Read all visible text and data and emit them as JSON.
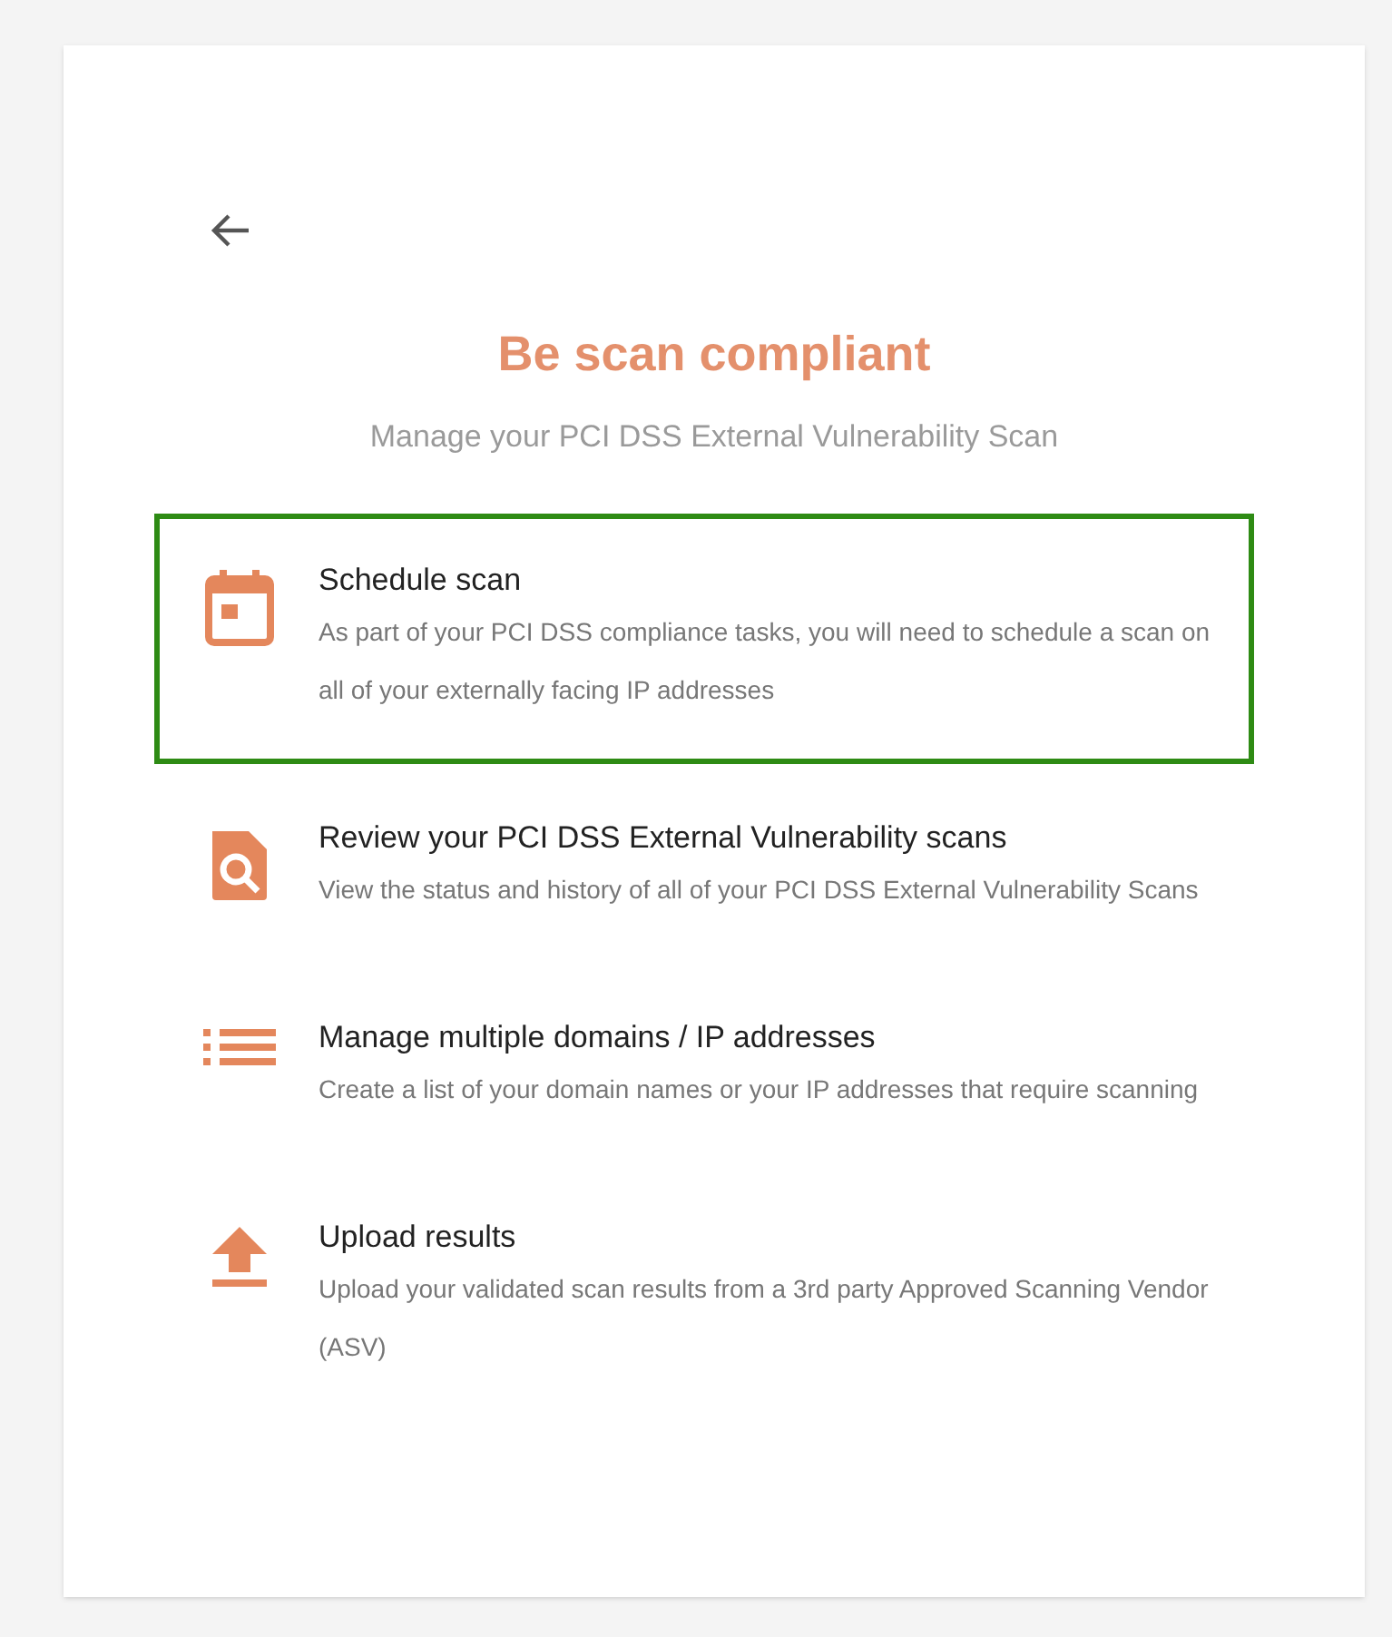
{
  "title": "Be scan compliant",
  "subtitle": "Manage your PCI DSS External Vulnerability Scan",
  "items": [
    {
      "kind": "calendar",
      "title": "Schedule scan",
      "description": "As part of your PCI DSS compliance tasks, you will need to schedule a scan on all of your externally facing IP addresses",
      "selected": true
    },
    {
      "kind": "review",
      "title": "Review your PCI DSS External Vulnerability scans",
      "description": "View the status and history of all of your PCI DSS External Vulnerability Scans",
      "selected": false
    },
    {
      "kind": "list",
      "title": "Manage multiple domains / IP addresses",
      "description": "Create a list of your domain names or your IP addresses that require scanning",
      "selected": false
    },
    {
      "kind": "upload",
      "title": "Upload results",
      "description": "Upload your validated scan results from a 3rd party Approved Scanning Vendor (ASV)",
      "selected": false
    }
  ]
}
